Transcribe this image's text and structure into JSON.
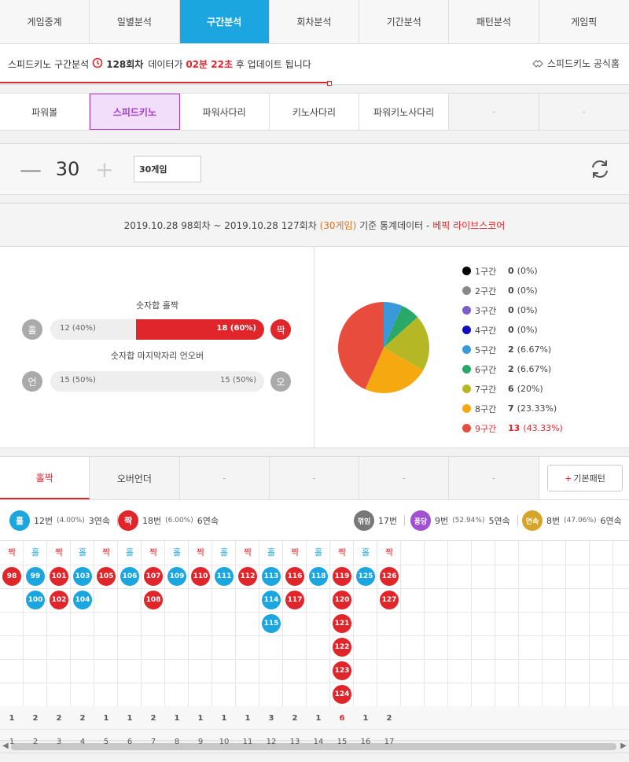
{
  "top_tabs": [
    "게임중계",
    "일별분석",
    "구간분석",
    "회차분석",
    "기간분석",
    "패턴분석",
    "게임픽"
  ],
  "notice": {
    "prefix": "스피드키노 구간분석",
    "round": "128회차",
    "mid": "데이터가",
    "time": "02분 22초",
    "suffix": "후 업데이트 됩니다",
    "right_link": "스피드키노 공식홈"
  },
  "game_tabs": [
    "파워볼",
    "스피드키노",
    "파워사다리",
    "키노사다리",
    "파워키노사다리",
    "-",
    "-"
  ],
  "count": {
    "minus": "—",
    "value": "30",
    "plus": "+",
    "select": "30게임"
  },
  "stat_head": {
    "range": "2019.10.28 98회차 ~ 2019.10.28 127회차",
    "games": "(30게임)",
    "suffix": "기준 통계데이터 -",
    "brand": "베픽 라이브스코어"
  },
  "bars": [
    {
      "title": "숫자합 홀짝",
      "left_icon": "홀",
      "right_icon": "짝",
      "left_text": "12 (40%)",
      "right_text": "18 (60%)",
      "right_fraction": 0.6,
      "right_active": true,
      "left_color": "#aaaaaa",
      "right_color": "#e0262a"
    },
    {
      "title": "숫자합 마지막자리 언오버",
      "left_icon": "언",
      "right_icon": "오",
      "left_text": "15 (50%)",
      "right_text": "15 (50%)",
      "right_fraction": 0,
      "right_active": false,
      "left_color": "#aaaaaa",
      "right_color": "#aaaaaa"
    }
  ],
  "chart_data": {
    "type": "pie",
    "categories": [
      "1구간",
      "2구간",
      "3구간",
      "4구간",
      "5구간",
      "6구간",
      "7구간",
      "8구간",
      "9구간"
    ],
    "values": [
      0,
      0,
      0,
      0,
      2,
      2,
      6,
      7,
      13
    ],
    "percents": [
      "(0%)",
      "(0%)",
      "(0%)",
      "(0%)",
      "(6.67%)",
      "(6.67%)",
      "(20%)",
      "(23.33%)",
      "(43.33%)"
    ],
    "colors": [
      "#000000",
      "#888888",
      "#7b5fc8",
      "#1010c0",
      "#3a9ad9",
      "#2aa868",
      "#b5b824",
      "#f5a810",
      "#e74c3c"
    ],
    "highlight_index": 8
  },
  "pattern_tabs": [
    "홀짝",
    "오버언더",
    "-",
    "-",
    "-",
    "-"
  ],
  "pattern_button": {
    "plus": "+",
    "label": "기본패턴"
  },
  "summary": {
    "odd": {
      "icon": "홀",
      "text": "12번",
      "pct": "(4.00%)",
      "streak": "3연속",
      "color": "#1ca6df"
    },
    "even": {
      "icon": "짝",
      "text": "18번",
      "pct": "(6.00%)",
      "streak": "6연속",
      "color": "#e0262a"
    },
    "break": {
      "icon": "꺾임",
      "text": "17번",
      "color": "#777777"
    },
    "bounce": {
      "icon": "퐁당",
      "text": "9번",
      "pct": "(52.94%)",
      "streak": "5연속",
      "color": "#a050d0"
    },
    "cont": {
      "icon": "연속",
      "text": "8번",
      "pct": "(47.06%)",
      "streak": "6연속",
      "color": "#d4a528"
    }
  },
  "grid": {
    "columns": [
      {
        "head": "짝",
        "type": "even",
        "balls": [
          "98"
        ]
      },
      {
        "head": "홀",
        "type": "odd",
        "balls": [
          "99",
          "100"
        ]
      },
      {
        "head": "짝",
        "type": "even",
        "balls": [
          "101",
          "102"
        ]
      },
      {
        "head": "홀",
        "type": "odd",
        "balls": [
          "103",
          "104"
        ]
      },
      {
        "head": "짝",
        "type": "even",
        "balls": [
          "105"
        ]
      },
      {
        "head": "홀",
        "type": "odd",
        "balls": [
          "106"
        ]
      },
      {
        "head": "짝",
        "type": "even",
        "balls": [
          "107",
          "108"
        ]
      },
      {
        "head": "홀",
        "type": "odd",
        "balls": [
          "109"
        ]
      },
      {
        "head": "짝",
        "type": "even",
        "balls": [
          "110"
        ]
      },
      {
        "head": "홀",
        "type": "odd",
        "balls": [
          "111"
        ]
      },
      {
        "head": "짝",
        "type": "even",
        "balls": [
          "112"
        ]
      },
      {
        "head": "홀",
        "type": "odd",
        "balls": [
          "113",
          "114",
          "115"
        ]
      },
      {
        "head": "짝",
        "type": "even",
        "balls": [
          "116",
          "117"
        ]
      },
      {
        "head": "홀",
        "type": "odd",
        "balls": [
          "118"
        ]
      },
      {
        "head": "짝",
        "type": "even",
        "balls": [
          "119",
          "120",
          "121",
          "122",
          "123",
          "124"
        ]
      },
      {
        "head": "홀",
        "type": "odd",
        "balls": [
          "125"
        ]
      },
      {
        "head": "짝",
        "type": "even",
        "balls": [
          "126",
          "127"
        ]
      }
    ],
    "counts": [
      "1",
      "2",
      "2",
      "2",
      "1",
      "1",
      "2",
      "1",
      "1",
      "1",
      "1",
      "3",
      "2",
      "1",
      "6",
      "1",
      "2"
    ],
    "count_highlight": 14,
    "indexes": [
      "1",
      "2",
      "3",
      "4",
      "5",
      "6",
      "7",
      "8",
      "9",
      "10",
      "11",
      "12",
      "13",
      "14",
      "15",
      "16",
      "17"
    ],
    "odd_color": "#1ca6df",
    "even_color": "#e0262a"
  }
}
